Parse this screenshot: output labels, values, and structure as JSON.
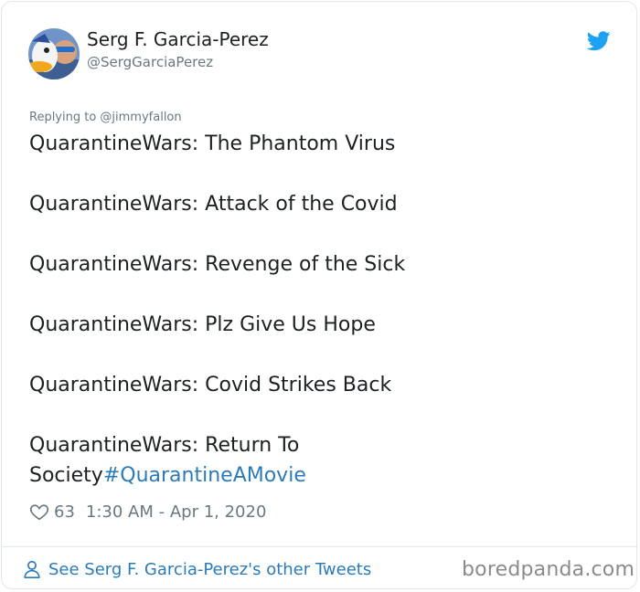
{
  "author": {
    "name": "Serg F. Garcia-Perez",
    "handle": "@SergGarciaPerez",
    "avatar_icon": "avatar-image",
    "platform_icon": "twitter-bird-icon"
  },
  "tweet": {
    "reply_context": "Replying to @jimmyfallon",
    "lines": [
      "QuarantineWars: The Phantom Virus",
      "QuarantineWars: Attack of the Covid",
      "QuarantineWars: Revenge of the Sick",
      "QuarantineWars: Plz Give Us Hope",
      "QuarantineWars: Covid Strikes Back",
      "QuarantineWars: Return To",
      "Society"
    ],
    "hashtag": "#QuarantineAMovie",
    "likes": "63",
    "timestamp": "1:30 AM - Apr 1, 2020"
  },
  "footer": {
    "link_label": "See Serg F. Garcia-Perez's other Tweets",
    "watermark": "boredpanda.com"
  },
  "colors": {
    "link": "#2b7bb9",
    "twitter_blue": "#1da1f2",
    "muted": "#697882",
    "border": "#e1e8ed"
  }
}
